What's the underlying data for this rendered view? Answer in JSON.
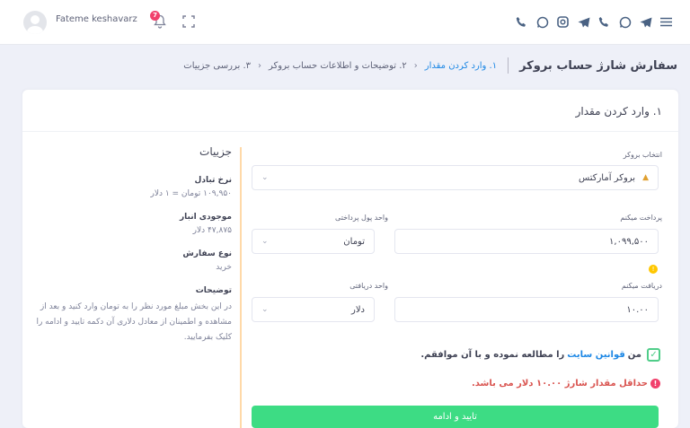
{
  "header": {
    "username": "Fateme keshavarz",
    "notification_count": "7",
    "icons": [
      "menu-icon",
      "telegram-icon",
      "whatsapp-icon",
      "phone-icon",
      "telegram-icon",
      "instagram-icon",
      "whatsapp-icon",
      "phone-icon"
    ]
  },
  "breadcrumb": {
    "title": "سفارش شارژ حساب بروکر",
    "step1": "۱. وارد کردن مقدار",
    "step2": "۲. توضیحات و اطلاعات حساب بروکر",
    "step3": "۳. بررسی جزییات"
  },
  "card": {
    "title": "۱. وارد کردن مقدار",
    "broker_label": "انتخاب بروکر",
    "broker_value": "بروکر آمارکتس",
    "pay_label": "پرداخت میکنم",
    "pay_value": "۱,۰۹۹,۵۰۰",
    "pay_unit_label": "واحد پول پرداختی",
    "pay_unit_value": "تومان",
    "receive_label": "دریافت میکنم",
    "receive_value": "۱۰.۰۰",
    "receive_unit_label": "واحد دریافتی",
    "receive_unit_value": "دلار",
    "agree_prefix": "من",
    "agree_link": "قوانین سایت",
    "agree_suffix": "را مطالعه نموده و با آن موافقم.",
    "error": "حداقل مقدار شارژ ۱۰.۰۰ دلار می باشد.",
    "submit": "تایید و ادامه"
  },
  "details": {
    "heading": "جزییات",
    "rate_label": "نرخ تبادل",
    "rate_value": "۱۰۹,۹۵۰ تومان = ۱ دلار",
    "stock_label": "موجودی انبار",
    "stock_value": "۴۷,۸۷۵ دلار",
    "order_label": "نوع سفارش",
    "order_value": "خرید",
    "desc_label": "توضیحات",
    "desc_text": "در این بخش مبلغ مورد نظر را به تومان وارد کنید و بعد از مشاهده و اطمینان از معادل دلاری آن دکمه تایید و ادامه را کلیک بفرمایید."
  },
  "colors": {
    "accent": "#1e88e5",
    "success": "#3ddc84",
    "danger": "#f1416c",
    "warning": "#ffc700"
  }
}
